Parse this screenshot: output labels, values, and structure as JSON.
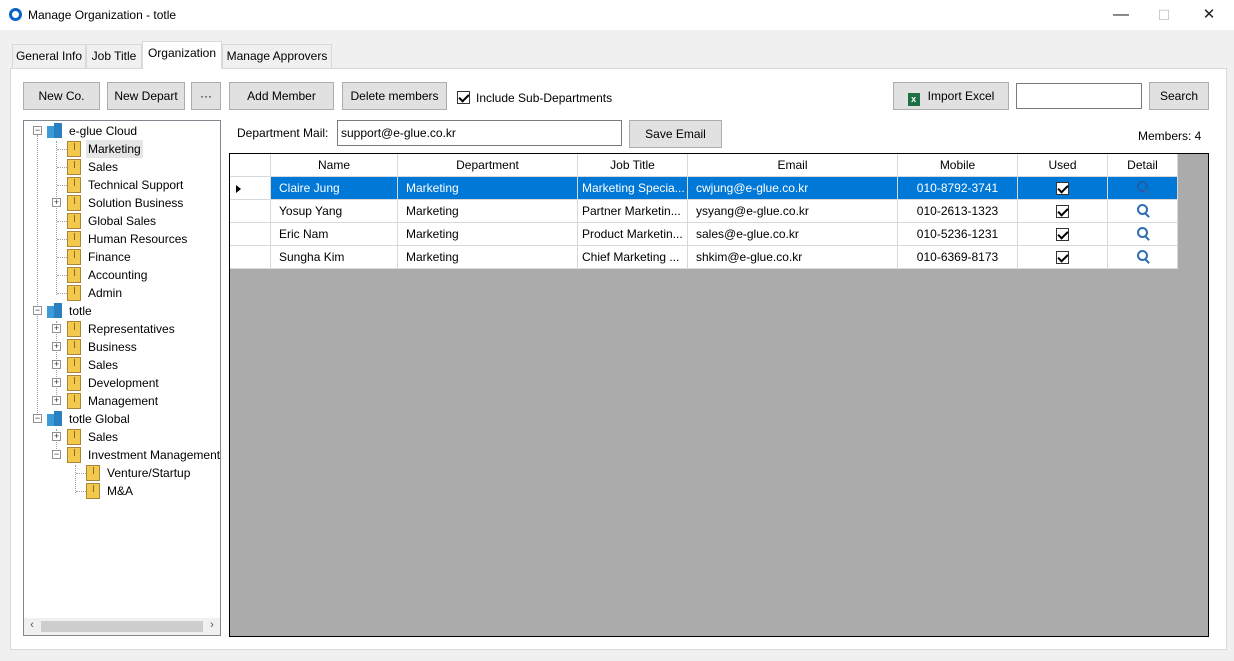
{
  "window": {
    "title": "Manage Organization - totle",
    "minimize_glyph": "—",
    "maximize_glyph": "☐",
    "close_glyph": "✕"
  },
  "tabs": [
    {
      "label": "General Info"
    },
    {
      "label": "Job Title"
    },
    {
      "label": "Organization",
      "active": true
    },
    {
      "label": "Manage Approvers"
    }
  ],
  "toolbar": {
    "new_co": "New Co.",
    "new_depart": "New Depart",
    "more": "···",
    "add_member": "Add Member",
    "delete_members": "Delete members",
    "include_sub_departments": "Include Sub-Departments",
    "include_sub_checked": true,
    "import_excel": "Import Excel",
    "search_value": "",
    "search": "Search"
  },
  "department_mail": {
    "label": "Department Mail:",
    "value": "support@e-glue.co.kr",
    "save_email": "Save Email"
  },
  "members_count": "Members: 4",
  "tree": {
    "companies": [
      {
        "name": "e-glue Cloud",
        "departments": [
          "Marketing",
          "Sales",
          "Technical Support",
          "Solution Business",
          "Global Sales",
          "Human Resources",
          "Finance",
          "Accounting",
          "Admin"
        ],
        "selected": "Marketing"
      },
      {
        "name": "totle",
        "departments": [
          "Representatives",
          "Business",
          "Sales",
          "Development",
          "Management"
        ]
      },
      {
        "name": "totle Global",
        "departments": [
          "Sales",
          "Investment Management"
        ],
        "sub_departments": [
          "Venture/Startup",
          "M&A"
        ]
      }
    ],
    "scroll_left": "‹",
    "scroll_right": "›"
  },
  "grid": {
    "columns": [
      "Name",
      "Department",
      "Job Title",
      "Email",
      "Mobile",
      "Used",
      "Detail"
    ],
    "rows": [
      {
        "name": "Claire Jung",
        "department": "Marketing",
        "job_title": "Marketing Specia...",
        "email": "cwjung@e-glue.co.kr",
        "mobile": "010-8792-3741",
        "used": true,
        "selected": true
      },
      {
        "name": "Yosup Yang",
        "department": "Marketing",
        "job_title": "Partner Marketin...",
        "email": "ysyang@e-glue.co.kr",
        "mobile": "010-2613-1323",
        "used": true
      },
      {
        "name": "Eric Nam",
        "department": "Marketing",
        "job_title": "Product Marketin...",
        "email": "sales@e-glue.co.kr",
        "mobile": "010-5236-1231",
        "used": true
      },
      {
        "name": "Sungha Kim",
        "department": "Marketing",
        "job_title": "Chief Marketing ...",
        "email": "shkim@e-glue.co.kr",
        "mobile": "010-6369-8173",
        "used": true
      }
    ]
  },
  "colors": {
    "selection": "#0078d7",
    "grid_background": "#ababab",
    "accent_icon": "#0a64c8"
  }
}
